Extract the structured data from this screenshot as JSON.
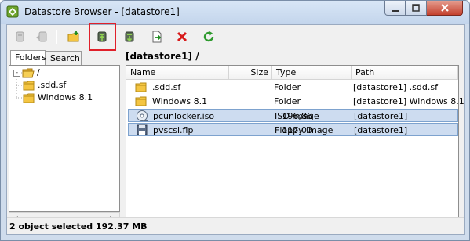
{
  "window": {
    "title": "Datastore Browser - [datastore1]",
    "controls": {
      "minimize_icon": "minimize-icon",
      "maximize_icon": "maximize-icon",
      "close_icon": "close-icon"
    }
  },
  "toolbar": {
    "buttons": [
      {
        "icon": "datastore-disabled-icon",
        "enabled": false
      },
      {
        "icon": "datastore-back-disabled-icon",
        "enabled": false
      },
      {
        "icon": "new-folder-icon",
        "enabled": true
      },
      {
        "icon": "upload-to-datastore-icon",
        "enabled": true,
        "highlighted": true
      },
      {
        "icon": "download-from-datastore-icon",
        "enabled": true
      },
      {
        "icon": "move-file-icon",
        "enabled": true
      },
      {
        "icon": "delete-icon",
        "enabled": true
      },
      {
        "icon": "refresh-icon",
        "enabled": true
      }
    ],
    "highlight_color": "#e0202a"
  },
  "left_panel": {
    "tabs": [
      {
        "label": "Folders",
        "active": true
      },
      {
        "label": "Search",
        "active": false
      }
    ],
    "tree": {
      "root": {
        "label": "/",
        "expander": "-"
      },
      "children": [
        {
          "label": ".sdd.sf"
        },
        {
          "label": "Windows 8.1"
        }
      ]
    }
  },
  "main": {
    "path_label": "[datastore1] /",
    "columns": {
      "name": "Name",
      "size": "Size",
      "type": "Type",
      "path": "Path"
    },
    "rows": [
      {
        "name": ".sdd.sf",
        "size": "",
        "type": "Folder",
        "path": "[datastore1] .sdd.sf",
        "icon": "folder-icon",
        "selected": false
      },
      {
        "name": "Windows 8.1",
        "size": "",
        "type": "Folder",
        "path": "[datastore1] Windows 8.1",
        "icon": "folder-icon",
        "selected": false
      },
      {
        "name": "pcunlocker.iso",
        "size": "196,86",
        "type": "ISO image",
        "path": "[datastore1]",
        "icon": "iso-image-icon",
        "selected": true
      },
      {
        "name": "pvscsi.flp",
        "size": "117.00",
        "type": "Floppy image",
        "path": "[datastore1]",
        "icon": "floppy-image-icon",
        "selected": true
      }
    ]
  },
  "status": {
    "text": "2 object selected 192.37 MB"
  },
  "colors": {
    "selection_bg": "#cddcf0",
    "selection_border": "#7da2ce",
    "window_frame": "#cfdcec"
  }
}
